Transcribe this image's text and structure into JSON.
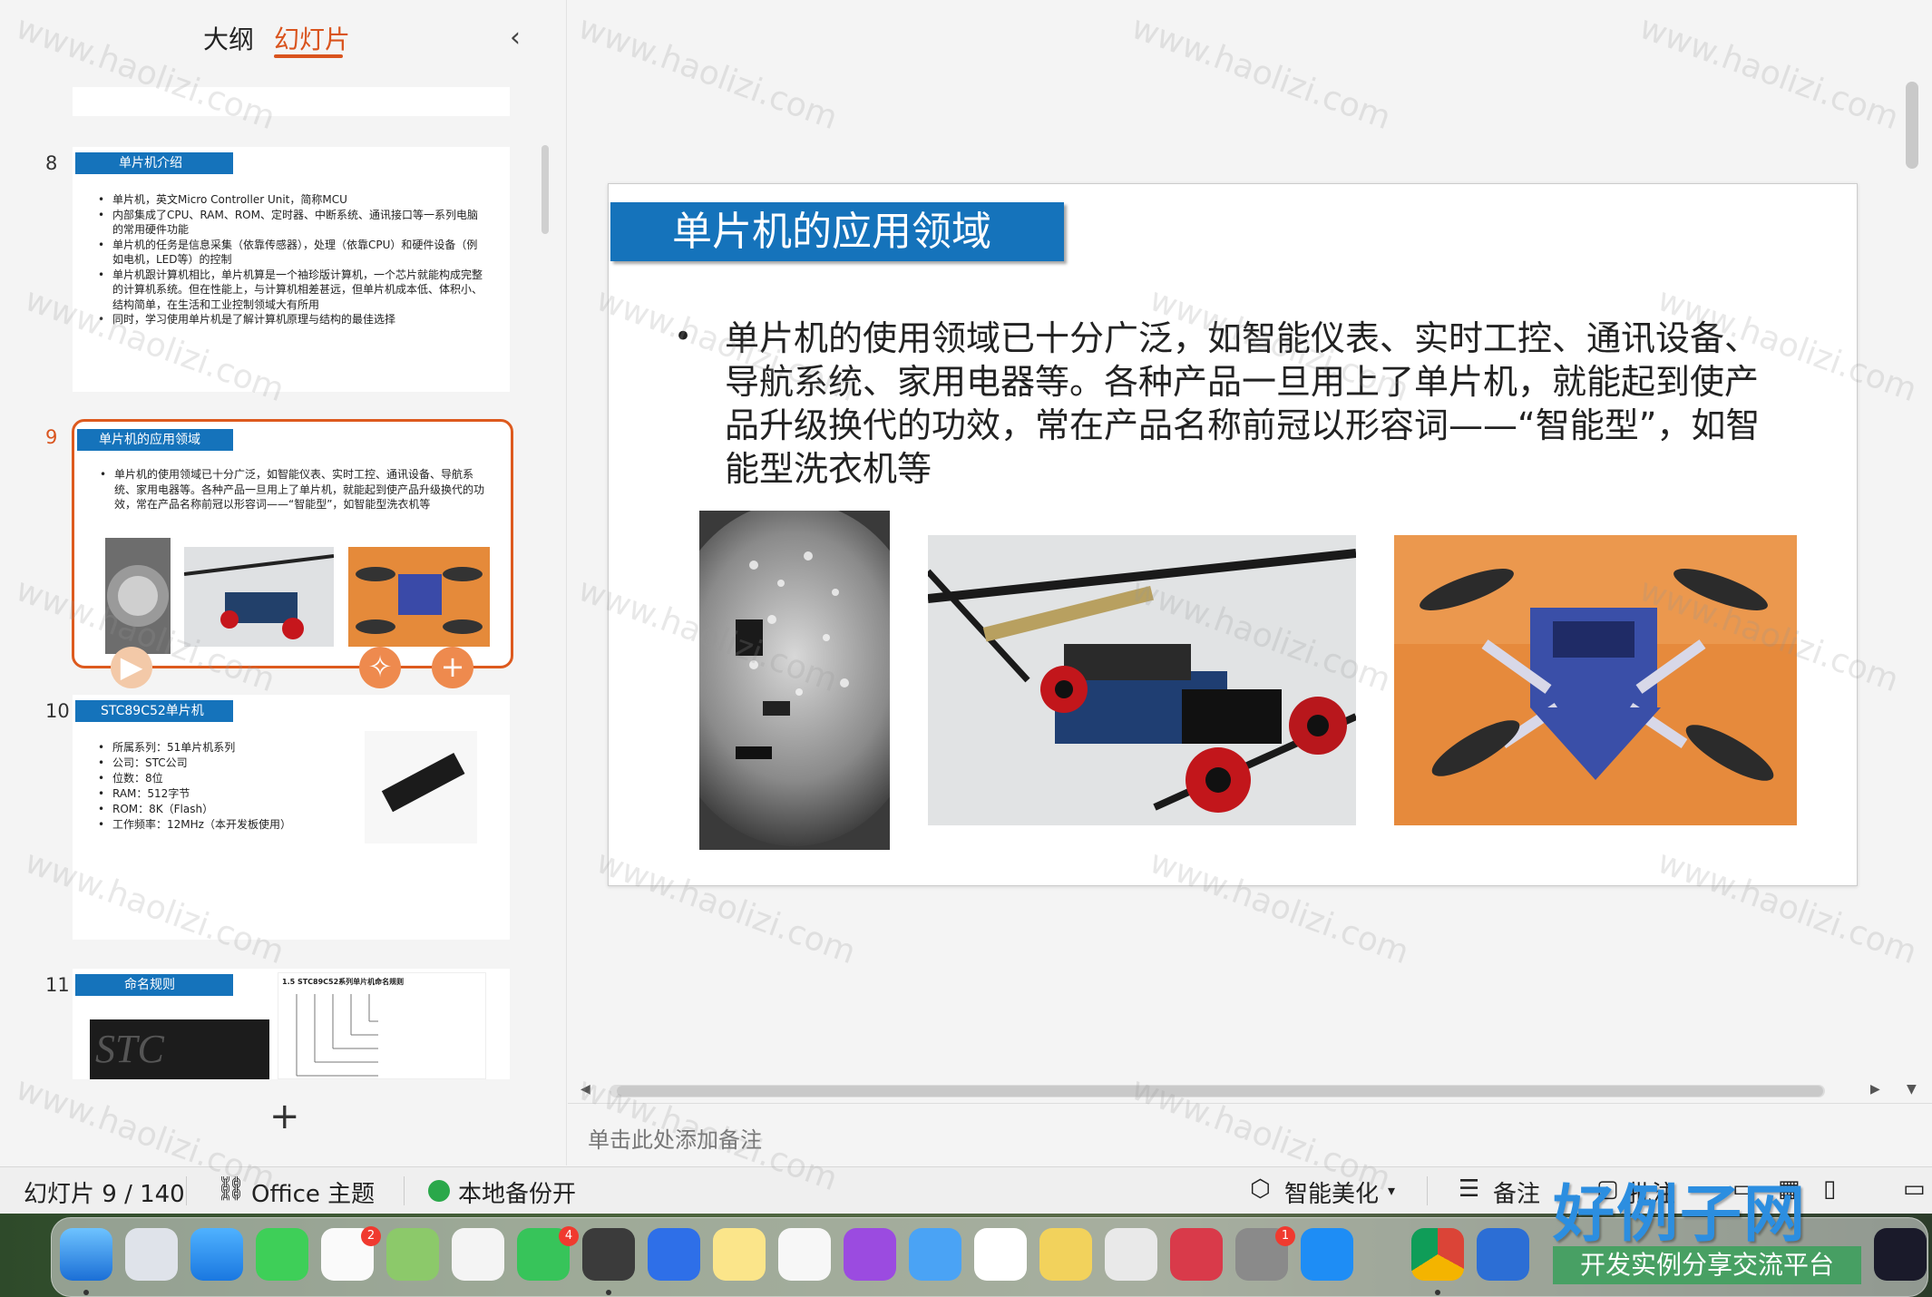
{
  "sidebar": {
    "tabs": [
      "大纲",
      "幻灯片"
    ],
    "collapse": "‹",
    "add": "+",
    "slides": [
      {
        "num": "8",
        "title": "单片机介绍",
        "bullets": [
          "单片机，英文Micro Controller Unit，简称MCU",
          "内部集成了CPU、RAM、ROM、定时器、中断系统、通讯接口等一系列电脑的常用硬件功能",
          "单片机的任务是信息采集（依靠传感器），处理（依靠CPU）和硬件设备（例如电机，LED等）的控制",
          "单片机跟计算机相比，单片机算是一个袖珍版计算机，一个芯片就能构成完整的计算机系统。但在性能上，与计算机相差甚远，但单片机成本低、体积小、结构简单，在生活和工业控制领域大有所用",
          "同时，学习使用单片机是了解计算机原理与结构的最佳选择"
        ]
      },
      {
        "num": "9",
        "title": "单片机的应用领域",
        "bullets": [
          "单片机的使用领域已十分广泛，如智能仪表、实时工控、通讯设备、导航系统、家用电器等。各种产品一旦用上了单片机，就能起到使产品升级换代的功效，常在产品名称前冠以形容词——“智能型”，如智能型洗衣机等"
        ]
      },
      {
        "num": "10",
        "title": "STC89C52单片机",
        "bullets": [
          "所属系列：51单片机系列",
          "公司：STC公司",
          "位数：8位",
          "RAM：512字节",
          "ROM：8K（Flash）",
          "工作频率：12MHz（本开发板使用）"
        ]
      },
      {
        "num": "11",
        "title": "命名规则",
        "naming_heading": "1.5 STC89C52系列单片机命名规则",
        "chip_text": "STC"
      }
    ]
  },
  "slide": {
    "title": "单片机的应用领域",
    "body": "单片机的使用领域已十分广泛，如智能仪表、实时工控、通讯设备、导航系统、家用电器等。各种产品一旦用上了单片机，就能起到使产品升级换代的功效，常在产品名称前冠以形容词——“智能型”，如智能型洗衣机等"
  },
  "notes_placeholder": "单击此处添加备注",
  "statusbar": {
    "slide_counter": "幻灯片 9 / 140",
    "theme": "Office 主题",
    "backup": "本地备份开",
    "beautify": "智能美化",
    "notes": "备注",
    "review": "批注"
  },
  "watermark": "www.haolizi.com",
  "brand": {
    "name": "好例子网",
    "tagline": "开发实例分享交流平台"
  },
  "dock": {
    "badges": {
      "reminders": "2",
      "facetime": "4",
      "settings": "1"
    }
  },
  "colors": {
    "accent": "#d9541e",
    "slide_title_bg": "#1573bb",
    "fab": "#ee8a4e"
  }
}
